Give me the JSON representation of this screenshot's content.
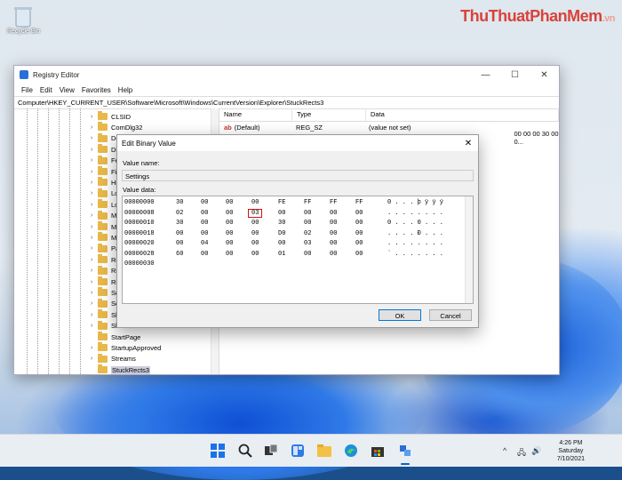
{
  "watermark": {
    "main": "ThuThuatPhanMem",
    "suffix": ".vn"
  },
  "desktop": {
    "icons": [
      {
        "label": "Recycle Bin",
        "icon": "recycle-bin-icon"
      }
    ]
  },
  "regedit": {
    "title": "Registry Editor",
    "controls": {
      "minimize": "—",
      "maximize": "☐",
      "close": "✕"
    },
    "menu": [
      "File",
      "Edit",
      "View",
      "Favorites",
      "Help"
    ],
    "address": "Computer\\HKEY_CURRENT_USER\\Software\\Microsoft\\Windows\\CurrentVersion\\Explorer\\StuckRects3",
    "tree": [
      "CLSID",
      "ComDlg32",
      "De",
      "Dis",
      "Fea",
      "File",
      "Hid",
      "Lo",
      "Lo",
      "Me",
      "Mo",
      "Mo",
      "Pa",
      "Re",
      "Rib",
      "Ru",
      "Sea",
      "Sea",
      "She",
      "She",
      "StartPage",
      "StartupApproved",
      "Streams",
      "StuckRects3"
    ],
    "selected_key": "StuckRects3",
    "columns": {
      "name": "Name",
      "type": "Type",
      "data": "Data"
    },
    "values": [
      {
        "name": "(Default)",
        "type": "REG_SZ",
        "data": "(value not set)"
      },
      {
        "name": "",
        "type": "",
        "data": "00 00 00 30 00 0..."
      }
    ]
  },
  "dialog": {
    "title": "Edit Binary Value",
    "close": "✕",
    "value_name_label": "Value name:",
    "value_name": "Settings",
    "value_data_label": "Value data:",
    "hex_rows": [
      {
        "offset": "00000000",
        "bytes": [
          "30",
          "00",
          "00",
          "00",
          "FE",
          "FF",
          "FF",
          "FF"
        ],
        "ascii": "0 . . . þ ÿ ÿ ÿ"
      },
      {
        "offset": "00000008",
        "bytes": [
          "02",
          "00",
          "00",
          "03",
          "00",
          "00",
          "00",
          "00"
        ],
        "ascii": ". . . . . . . ."
      },
      {
        "offset": "00000010",
        "bytes": [
          "30",
          "00",
          "00",
          "00",
          "30",
          "00",
          "00",
          "00"
        ],
        "ascii": "0 . . . 0 . . ."
      },
      {
        "offset": "00000018",
        "bytes": [
          "00",
          "00",
          "00",
          "00",
          "D0",
          "02",
          "00",
          "00"
        ],
        "ascii": ". . . . Ð . . ."
      },
      {
        "offset": "00000020",
        "bytes": [
          "00",
          "04",
          "00",
          "00",
          "00",
          "03",
          "00",
          "00"
        ],
        "ascii": ". . . . . . . ."
      },
      {
        "offset": "00000028",
        "bytes": [
          "60",
          "00",
          "00",
          "00",
          "01",
          "00",
          "00",
          "00"
        ],
        "ascii": "` . . . . . . ."
      },
      {
        "offset": "00000030",
        "bytes": [],
        "ascii": ""
      }
    ],
    "highlighted": {
      "row": 1,
      "byte": 3,
      "value": "03",
      "color": "#d11111"
    },
    "ok_label": "OK",
    "cancel_label": "Cancel"
  },
  "taskbar": {
    "icons": [
      "start-icon",
      "search-icon",
      "task-view-icon",
      "widgets-icon",
      "file-explorer-icon",
      "edge-icon",
      "store-icon",
      "regedit-icon"
    ],
    "time": "4:26 PM",
    "day": "Saturday",
    "date": "7/10/2021",
    "tray_glyphs": [
      "^",
      "🖧",
      "🔊"
    ]
  },
  "colors": {
    "accent": "#0078d7",
    "folder": "#e8b84a",
    "highlight": "#d11111"
  }
}
